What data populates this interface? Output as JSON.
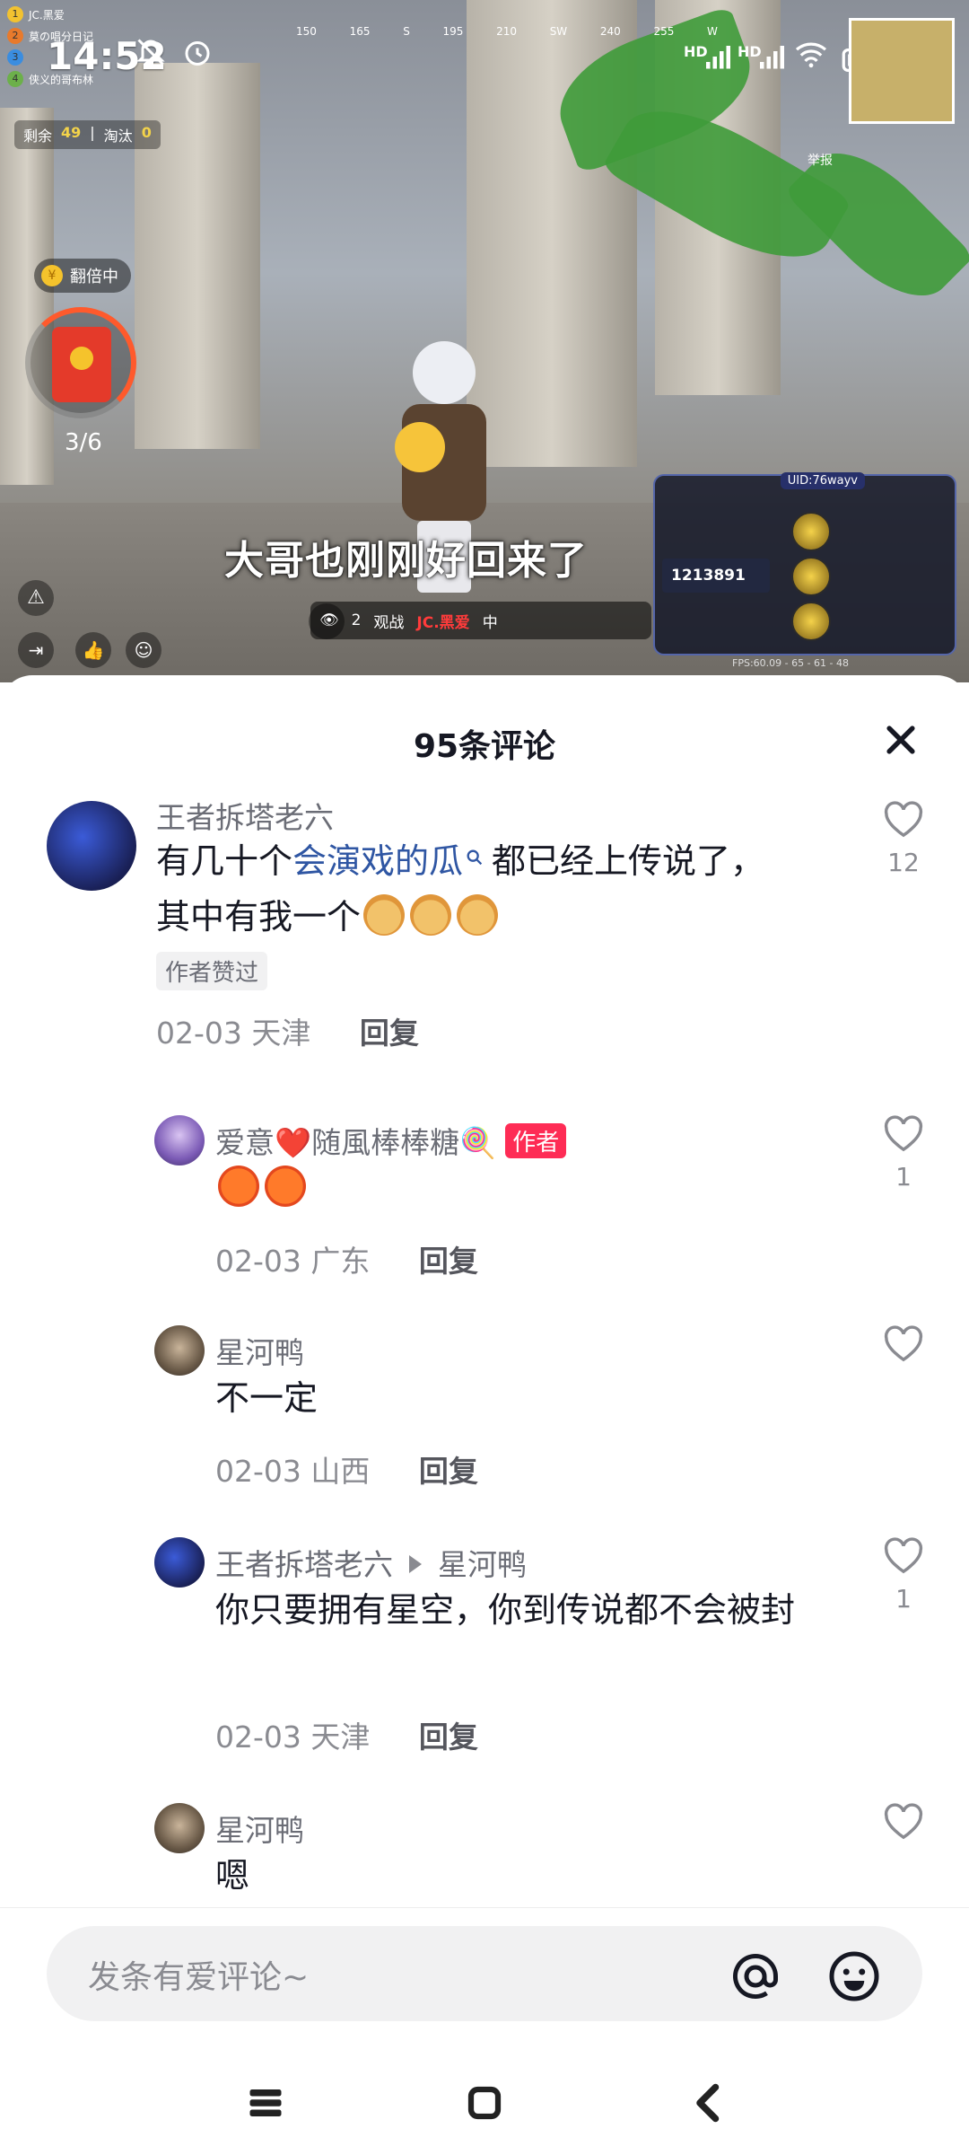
{
  "status_bar": {
    "time": "14:52",
    "hd1": "HD",
    "hd2": "HD"
  },
  "game": {
    "leaderboard": [
      "JC.黑爱",
      "莫の唱分日记",
      "",
      "侠义的哥布林"
    ],
    "remaining_label": "剩余",
    "remaining_value": "49",
    "eliminated_label": "淘汰",
    "eliminated_value": "0",
    "compass": [
      "150",
      "165",
      "S",
      "195",
      "210",
      "SW",
      "240",
      "255",
      "W"
    ],
    "double_badge": "翻倍中",
    "redpack_count": "3/6",
    "subtitle": "大哥也刚刚好回来了",
    "spectate_count": "2",
    "spectate_label": "观战",
    "player_name": "JC.黑爱",
    "mid_label": "中",
    "report_label": "举报",
    "uid": "UID:76wayv",
    "score": "1213891",
    "fps": "FPS:60.09 - 65 - 61 - 48"
  },
  "comments_header": {
    "title": "95条评论"
  },
  "comments": [
    {
      "nick": "王者拆塔老六",
      "text_before": "有几十个",
      "link": "会演戏的瓜",
      "text_after": "都已经上传说了，其中有我一个",
      "badge": "作者赞过",
      "date": "02-03",
      "location": "天津",
      "reply": "回复",
      "likes": "12"
    },
    {
      "nick": "爱意❤️随風棒棒糖🍭",
      "author_tag": "作者",
      "date": "02-03",
      "location": "广东",
      "reply": "回复",
      "likes": "1"
    },
    {
      "nick": "星河鸭",
      "text": "不一定",
      "date": "02-03",
      "location": "山西",
      "reply": "回复",
      "likes": ""
    },
    {
      "nick": "王者拆塔老六",
      "reply_to": "星河鸭",
      "text": "你只要拥有星空，你到传说都不会被封",
      "date": "02-03",
      "location": "天津",
      "reply": "回复",
      "likes": "1"
    },
    {
      "nick": "星河鸭",
      "text": "嗯",
      "likes": ""
    }
  ],
  "input": {
    "placeholder": "发条有爱评论~"
  },
  "icons": {
    "like": "heart-outline-icon",
    "close": "close-icon",
    "at": "at-icon",
    "emoji": "smiley-icon",
    "nav": [
      "menu-icon",
      "home-icon",
      "back-icon"
    ]
  },
  "colors": {
    "link": "#2f56a3",
    "author_tag": "#fe2c55",
    "secondary_text": "#8a8b91"
  }
}
